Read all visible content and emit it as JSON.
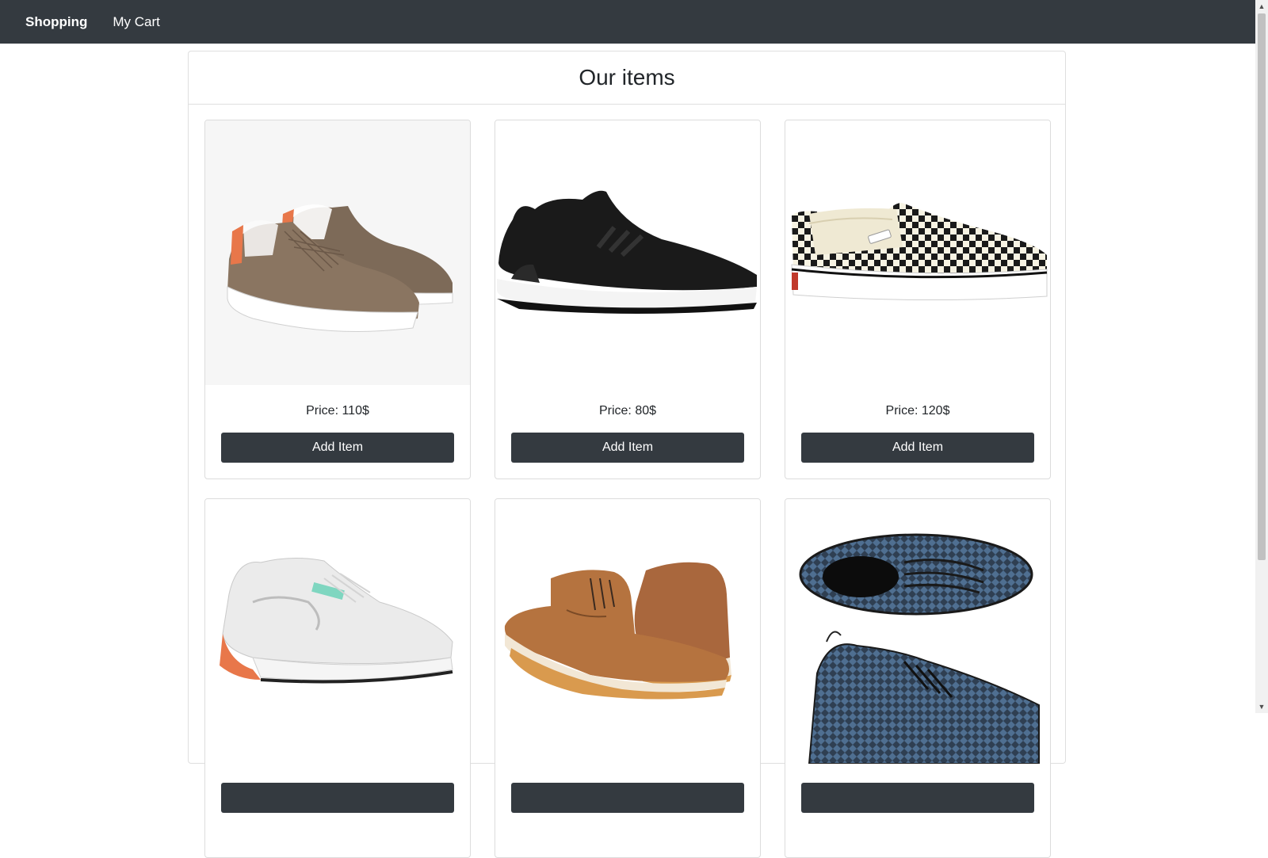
{
  "navbar": {
    "brand": "Shopping",
    "cart_link": "My Cart"
  },
  "page": {
    "title": "Our items"
  },
  "items": [
    {
      "price_text": "Price: 110$",
      "button_label": "Add Item",
      "image": "brown-suede-sneakers"
    },
    {
      "price_text": "Price: 80$",
      "button_label": "Add Item",
      "image": "black-running-shoe"
    },
    {
      "price_text": "Price: 120$",
      "button_label": "Add Item",
      "image": "checkered-slip-on"
    },
    {
      "price_text": "",
      "button_label": "",
      "image": "white-chunky-sneaker"
    },
    {
      "price_text": "",
      "button_label": "",
      "image": "brown-leather-boots"
    },
    {
      "price_text": "",
      "button_label": "",
      "image": "blue-knit-sneakers"
    }
  ],
  "colors": {
    "navbar_bg": "#343a40",
    "button_bg": "#343a40",
    "button_text": "#ffffff"
  }
}
